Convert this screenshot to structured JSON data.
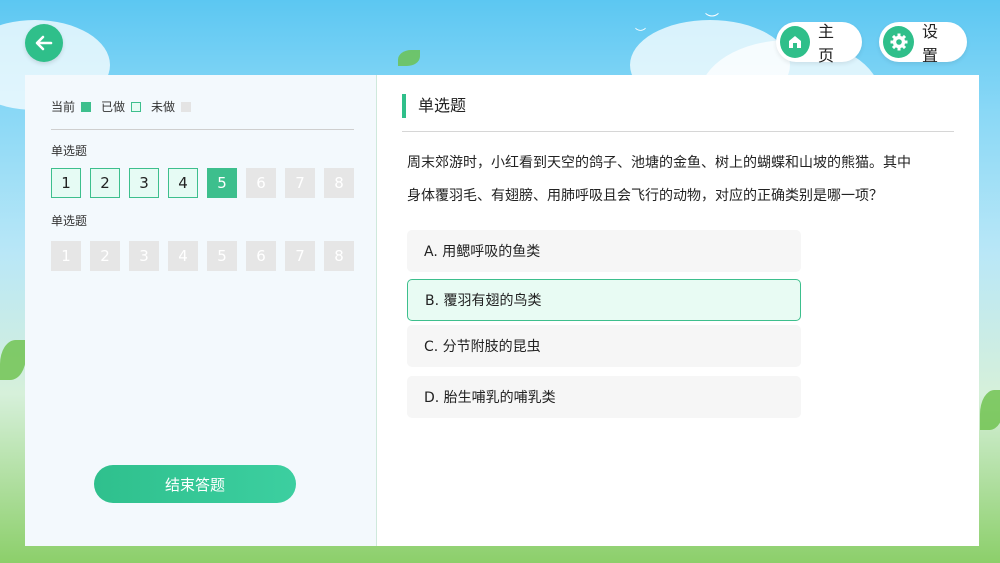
{
  "nav": {
    "home_label": "主页",
    "settings_label": "设置"
  },
  "legend": {
    "current": "当前",
    "done": "已做",
    "undone": "未做"
  },
  "sidebar": {
    "sections": [
      {
        "title": "单选题",
        "items": [
          {
            "n": "1",
            "state": "done"
          },
          {
            "n": "2",
            "state": "done"
          },
          {
            "n": "3",
            "state": "done"
          },
          {
            "n": "4",
            "state": "done"
          },
          {
            "n": "5",
            "state": "current"
          },
          {
            "n": "6",
            "state": "undone"
          },
          {
            "n": "7",
            "state": "undone"
          },
          {
            "n": "8",
            "state": "undone"
          }
        ]
      },
      {
        "title": "单选题",
        "items": [
          {
            "n": "1",
            "state": "undone"
          },
          {
            "n": "2",
            "state": "undone"
          },
          {
            "n": "3",
            "state": "undone"
          },
          {
            "n": "4",
            "state": "undone"
          },
          {
            "n": "5",
            "state": "undone"
          },
          {
            "n": "6",
            "state": "undone"
          },
          {
            "n": "7",
            "state": "undone"
          },
          {
            "n": "8",
            "state": "undone"
          }
        ]
      }
    ],
    "finish_label": "结束答题"
  },
  "question": {
    "type": "单选题",
    "line1": "周末郊游时，小红看到天空的鸽子、池塘的金鱼、树上的蝴蝶和山坡的熊猫。其中",
    "line2": "身体覆羽毛、有翅膀、用肺呼吸且会飞行的动物，对应的正确类别是哪一项？",
    "options": [
      {
        "text": "A. 用鳃呼吸的鱼类",
        "selected": false
      },
      {
        "text": "B. 覆羽有翅的鸟类",
        "selected": true
      },
      {
        "text": "C. 分节附肢的昆虫",
        "selected": false
      },
      {
        "text": "D. 胎生哺乳的哺乳类",
        "selected": false
      }
    ]
  },
  "colors": {
    "accent": "#3dbf8d",
    "done_fill": "#e6fbf4",
    "undone_fill": "#e6e6e6"
  },
  "icons": {
    "back": "arrow-left-icon",
    "home": "home-icon",
    "settings": "gear-icon"
  }
}
